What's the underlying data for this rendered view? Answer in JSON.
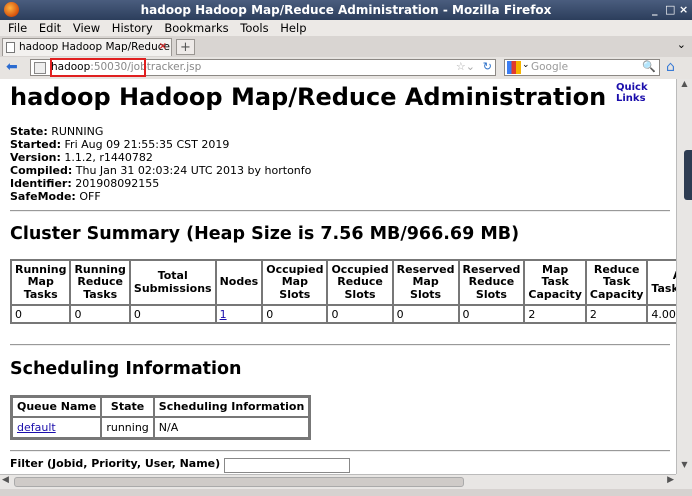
{
  "window": {
    "title": "hadoop Hadoop Map/Reduce Administration - Mozilla Firefox",
    "min": "_",
    "max": "□",
    "close": "×"
  },
  "menu": [
    "File",
    "Edit",
    "View",
    "History",
    "Bookmarks",
    "Tools",
    "Help"
  ],
  "tab": {
    "label": "hadoop Hadoop Map/Reduce Ad...",
    "close": "×",
    "new": "+",
    "list": "⌄"
  },
  "url": {
    "host": "hadoop",
    "rest": ":50030/jobtracker.jsp"
  },
  "search": {
    "placeholder": "Google"
  },
  "page": {
    "heading": "hadoop Hadoop Map/Reduce Administration",
    "quick_links": "Quick Links",
    "info": [
      {
        "label": "State:",
        "value": "RUNNING"
      },
      {
        "label": "Started:",
        "value": "Fri Aug 09 21:55:35 CST 2019"
      },
      {
        "label": "Version:",
        "value": "1.1.2, r1440782"
      },
      {
        "label": "Compiled:",
        "value": "Thu Jan 31 02:03:24 UTC 2013 by hortonfo"
      },
      {
        "label": "Identifier:",
        "value": "201908092155"
      },
      {
        "label": "SafeMode:",
        "value": "OFF"
      }
    ],
    "cluster_heading": "Cluster Summary (Heap Size is 7.56 MB/966.69 MB)",
    "cluster_headers": [
      "Running Map Tasks",
      "Running Reduce Tasks",
      "Total Submissions",
      "Nodes",
      "Occupied Map Slots",
      "Occupied Reduce Slots",
      "Reserved Map Slots",
      "Reserved Reduce Slots",
      "Map Task Capacity",
      "Reduce Task Capacity",
      "Avg. Tasks/Node"
    ],
    "cluster_values": [
      "0",
      "0",
      "0",
      "1",
      "0",
      "0",
      "0",
      "0",
      "2",
      "2",
      "4.00"
    ],
    "sched_heading": "Scheduling Information",
    "sched_headers": [
      "Queue Name",
      "State",
      "Scheduling Information"
    ],
    "sched_row": [
      "default",
      "running",
      "N/A"
    ],
    "filter_label": "Filter (Jobid, Priority, User, Name)"
  }
}
